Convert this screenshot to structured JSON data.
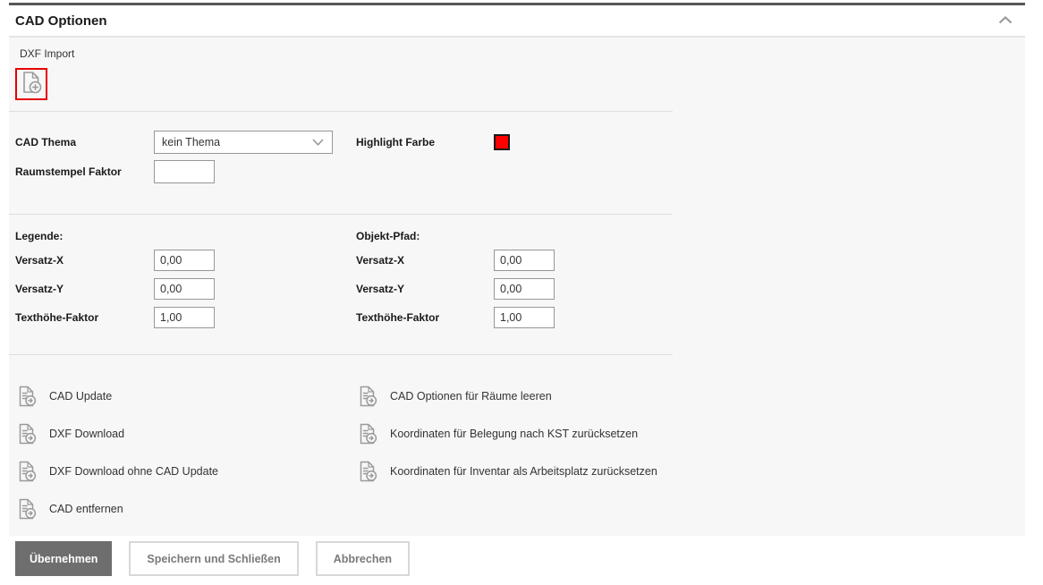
{
  "panel": {
    "title": "CAD Optionen"
  },
  "dxf_import": {
    "label": "DXF Import"
  },
  "theme_row": {
    "cad_thema_label": "CAD Thema",
    "cad_thema_value": "kein Thema",
    "highlight_farbe_label": "Highlight Farbe",
    "highlight_color": "#ff0000",
    "raumstempel_faktor_label": "Raumstempel Faktor",
    "raumstempel_faktor_value": ""
  },
  "legende": {
    "title": "Legende:",
    "fields": [
      {
        "label": "Versatz-X",
        "value": "0,00"
      },
      {
        "label": "Versatz-Y",
        "value": "0,00"
      },
      {
        "label": "Texthöhe-Faktor",
        "value": "1,00"
      }
    ]
  },
  "objekt_pfad": {
    "title": "Objekt-Pfad:",
    "fields": [
      {
        "label": "Versatz-X",
        "value": "0,00"
      },
      {
        "label": "Versatz-Y",
        "value": "0,00"
      },
      {
        "label": "Texthöhe-Faktor",
        "value": "1,00"
      }
    ]
  },
  "actions": {
    "left": [
      "CAD Update",
      "DXF Download",
      "DXF Download ohne CAD Update",
      "CAD entfernen"
    ],
    "right": [
      "CAD Optionen für Räume leeren",
      "Koordinaten für Belegung nach KST zurücksetzen",
      "Koordinaten für Inventar als Arbeitsplatz zurücksetzen"
    ]
  },
  "footer": {
    "apply_label": "Übernehmen",
    "save_close_label": "Speichern und Schließen",
    "cancel_label": "Abbrechen"
  },
  "colors": {
    "accent_red": "#ff0000",
    "topbar_gray": "#58585a",
    "primary_button_bg": "#6e6e6e",
    "icon_gray": "#9a9a9a",
    "content_bg": "#f7f7f7"
  }
}
